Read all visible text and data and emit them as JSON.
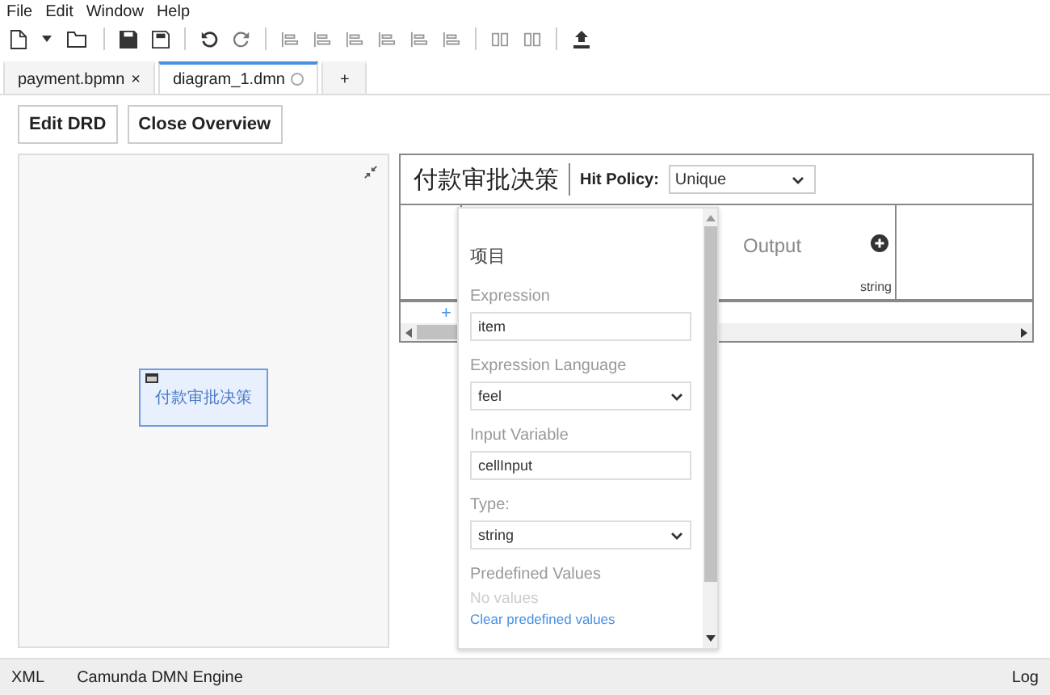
{
  "menu": [
    "File",
    "Edit",
    "Window",
    "Help"
  ],
  "tabs": [
    {
      "label": "payment.bpmn",
      "close": "×",
      "selected": false,
      "dirty": false
    },
    {
      "label": "diagram_1.dmn",
      "selected": true,
      "dirty": true
    }
  ],
  "new_tab": "+",
  "buttons": [
    "Edit DRD",
    "Close Overview"
  ],
  "overview": {
    "node_label": "付款审批决策"
  },
  "table": {
    "title": "付款审批决策",
    "hit_policy_label": "Hit Policy:",
    "hit_policy": "Unique",
    "output_label": "Output",
    "output_type": "string",
    "add_rule": "+"
  },
  "popup": {
    "heading": "项目",
    "fields": [
      {
        "kind": "input",
        "label": "Expression",
        "value": "item"
      },
      {
        "kind": "select",
        "label": "Expression Language",
        "value": "feel"
      },
      {
        "kind": "input",
        "label": "Input Variable",
        "value": "cellInput"
      },
      {
        "kind": "select",
        "label": "Type:",
        "value": "string"
      }
    ],
    "predefined_label": "Predefined Values",
    "predefined_empty": "No values",
    "clear_link": "Clear predefined values"
  },
  "status_bar": {
    "left": [
      "XML",
      "Camunda DMN Engine"
    ],
    "right": "Log"
  }
}
